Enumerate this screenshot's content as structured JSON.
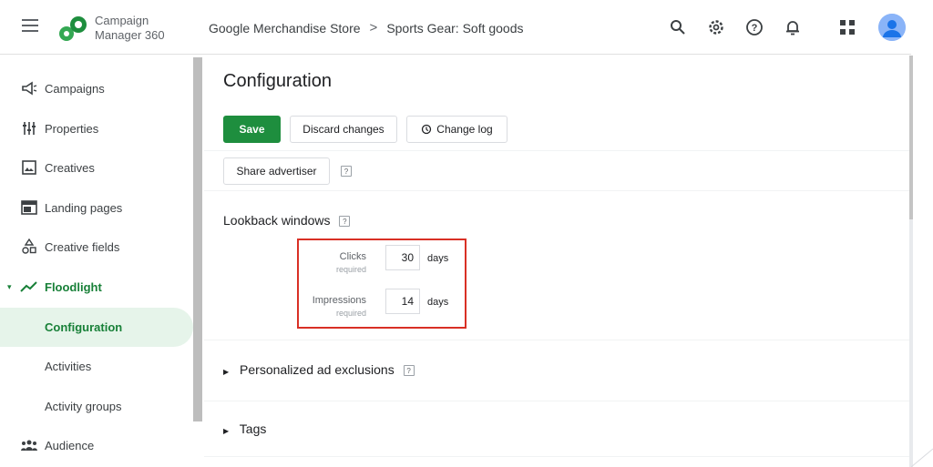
{
  "app": {
    "name_line1": "Campaign",
    "name_line2": "Manager 360"
  },
  "breadcrumb": {
    "advertiser": "Google Merchandise Store",
    "separator": ">",
    "campaign": "Sports Gear: Soft goods"
  },
  "top_icons": [
    "search-icon",
    "gear-icon",
    "help-icon",
    "bell-icon",
    "apps-icon"
  ],
  "sidebar": {
    "items": [
      {
        "label": "Campaigns",
        "icon": "megaphone-icon"
      },
      {
        "label": "Properties",
        "icon": "sliders-icon"
      },
      {
        "label": "Creatives",
        "icon": "image-icon"
      },
      {
        "label": "Landing pages",
        "icon": "web-icon"
      },
      {
        "label": "Creative fields",
        "icon": "shapes-icon"
      },
      {
        "label": "Floodlight",
        "icon": "trend-icon"
      },
      {
        "label": "Configuration"
      },
      {
        "label": "Activities"
      },
      {
        "label": "Activity groups"
      },
      {
        "label": "Audience",
        "icon": "people-icon"
      }
    ]
  },
  "main": {
    "title": "Configuration",
    "save_label": "Save",
    "discard_label": "Discard changes",
    "changelog_label": "Change log",
    "share_label": "Share advertiser",
    "help_mark": "?",
    "lookback": {
      "title": "Lookback windows",
      "clicks_label": "Clicks",
      "clicks_sub": "required",
      "clicks_value": "30",
      "impressions_label": "Impressions",
      "impressions_sub": "required",
      "impressions_value": "14",
      "unit": "days"
    },
    "personalized_title": "Personalized ad exclusions",
    "tags_title": "Tags"
  },
  "colors": {
    "brand_green": "#1e8e3e",
    "selected_bg": "#e6f4ea",
    "highlight_red": "#d93025"
  }
}
